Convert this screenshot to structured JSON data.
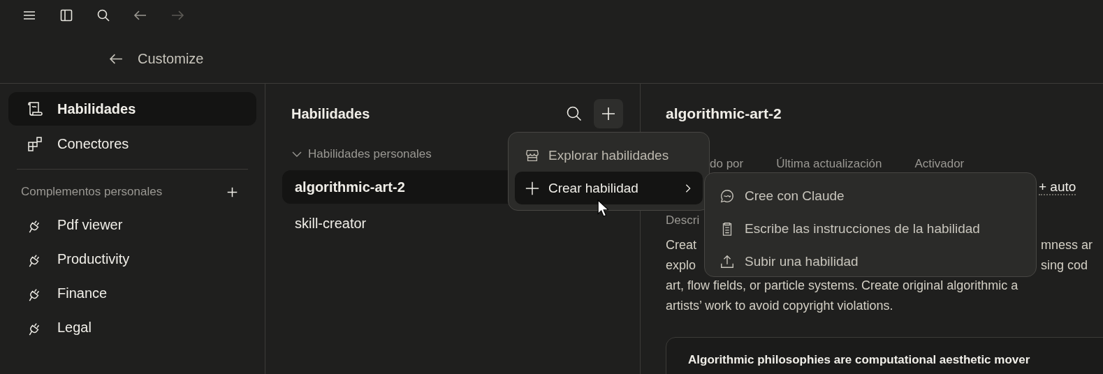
{
  "top_bar": {
    "nav": [
      {
        "kind": "back",
        "disabled": false
      },
      {
        "kind": "forward",
        "disabled": true
      }
    ]
  },
  "header": {
    "title": "Customize"
  },
  "sidebar": {
    "items": [
      {
        "label": "Habilidades",
        "selected": true
      },
      {
        "label": "Conectores",
        "selected": false
      }
    ],
    "section": {
      "title": "Complementos personales"
    },
    "plugins": [
      {
        "label": "Pdf viewer",
        "selected": false
      },
      {
        "label": "Productivity",
        "selected": false
      },
      {
        "label": "Finance",
        "selected": false
      },
      {
        "label": "Legal",
        "selected": false
      }
    ]
  },
  "skills_panel": {
    "title": "Habilidades",
    "group": {
      "label": "Habilidades personales",
      "expanded": true,
      "items": [
        {
          "label": "algorithmic-art-2",
          "selected": true
        },
        {
          "label": "skill-creator",
          "selected": false
        }
      ]
    }
  },
  "detail": {
    "title": "algorithmic-art-2",
    "meta_labels": [
      "do por",
      "Última actualización",
      "Activador"
    ],
    "trigger_value": "+ auto",
    "description_label": "Descri",
    "description_lines": [
      {
        "left": "Creat",
        "right": "mness ar"
      },
      {
        "left": "explo",
        "right": "sing cod"
      },
      {
        "left": "art, flow fields, or particle systems. Create original algorithmic a"
      },
      {
        "left": "artists’ work to avoid copyright violations."
      }
    ],
    "card_text": "Algorithmic philosophies are computational aesthetic mover"
  },
  "add_menu": {
    "items": [
      {
        "label": "Explorar habilidades",
        "selected": false,
        "has_submenu": false
      },
      {
        "label": "Crear habilidad",
        "selected": true,
        "has_submenu": true
      }
    ]
  },
  "submenu": {
    "items": [
      {
        "label": "Cree con Claude"
      },
      {
        "label": "Escribe las instrucciones de la habilidad"
      },
      {
        "label": "Subir una habilidad"
      }
    ]
  }
}
